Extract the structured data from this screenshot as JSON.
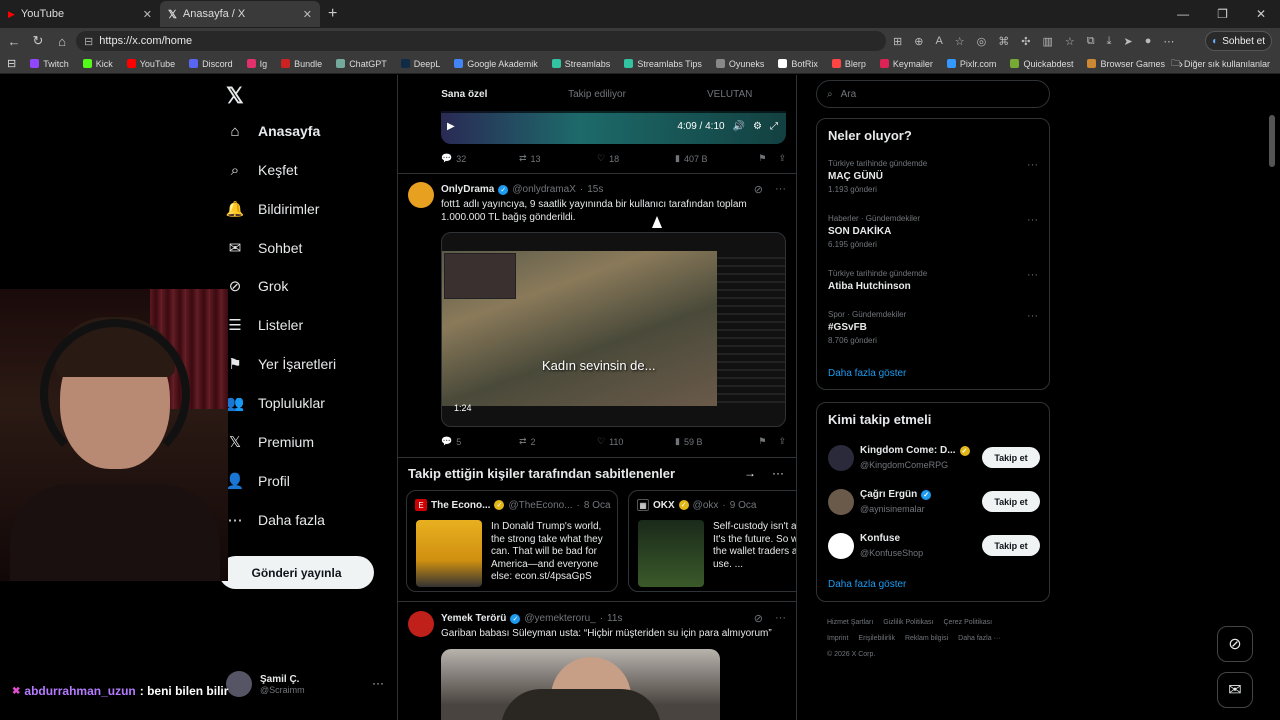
{
  "browser": {
    "tabs": [
      {
        "label": "YouTube",
        "active": false
      },
      {
        "label": "Anasayfa / X",
        "active": true
      }
    ],
    "url": "https://x.com/home",
    "sohbet_label": "Sohbet et",
    "bookmarks": [
      "Twitch",
      "Kick",
      "YouTube",
      "Discord",
      "Ig",
      "Bundle",
      "ChatGPT",
      "DeepL",
      "Google Akademik",
      "Streamlabs",
      "Streamlabs Tips",
      "Oyuneks",
      "BotRix",
      "Blerp",
      "Keymailer",
      "Pixlr.com",
      "Quickabdest",
      "Browser Games"
    ],
    "bookmarks_other": "Diğer sık kullanılanlar",
    "bookmark_colors": [
      "#9146ff",
      "#53fc18",
      "#ff0000",
      "#5865f2",
      "#e1306c",
      "#cc2222",
      "#74aa9c",
      "#0f2b46",
      "#4285f4",
      "#31c3a2",
      "#31c3a2",
      "#888888",
      "#ffffff",
      "#ff4444",
      "#dd2255",
      "#3399ff",
      "#77aa33",
      "#cc8833"
    ]
  },
  "nav": {
    "items": [
      {
        "label": "Anasayfa",
        "icon": "home-icon",
        "glyph": "⌂"
      },
      {
        "label": "Keşfet",
        "icon": "search-icon",
        "glyph": "⌕"
      },
      {
        "label": "Bildirimler",
        "icon": "bell-icon",
        "glyph": "🔔"
      },
      {
        "label": "Sohbet",
        "icon": "mail-icon",
        "glyph": "✉"
      },
      {
        "label": "Grok",
        "icon": "grok-icon",
        "glyph": "⊘"
      },
      {
        "label": "Listeler",
        "icon": "list-icon",
        "glyph": "☰"
      },
      {
        "label": "Yer İşaretleri",
        "icon": "bookmark-icon",
        "glyph": "⚑"
      },
      {
        "label": "Topluluklar",
        "icon": "communities-icon",
        "glyph": "👥"
      },
      {
        "label": "Premium",
        "icon": "x-premium-icon",
        "glyph": "𝕏"
      },
      {
        "label": "Profil",
        "icon": "profile-icon",
        "glyph": "👤"
      },
      {
        "label": "Daha fazla",
        "icon": "more-icon",
        "glyph": "⋯"
      }
    ],
    "post_button": "Gönderi yayınla",
    "profile": {
      "name": "Şamil Ç.",
      "handle": "@Scraimm"
    }
  },
  "overlay": {
    "chat_user": "abdurrahman_uzun",
    "chat_message": ": beni bilen bilir"
  },
  "feed": {
    "tabs": [
      "Sana özel",
      "Takip ediliyor",
      "VELUTAN"
    ],
    "video1": {
      "time": "4:09 / 4:10"
    },
    "tweet1_actions": {
      "replies": "32",
      "retweets": "13",
      "likes": "18",
      "views": "407 B"
    },
    "tweet2": {
      "name": "OnlyDrama",
      "handle": "@onlydramaX",
      "time": "15s",
      "text": "fott1 adlı yayıncıya, 9 saatlik yayınında bir kullanıcı tarafından toplam 1.000.000 TL bağış gönderildi.",
      "subtitle": "Kadın sevinsin de...",
      "duration": "1:24",
      "actions": {
        "replies": "5",
        "retweets": "2",
        "likes": "110",
        "views": "59 B"
      }
    },
    "pinned_title": "Takip ettiğin kişiler tarafından sabitlenenler",
    "pinned": [
      {
        "name": "The Econo...",
        "handle": "@TheEcono...",
        "time": "8 Oca",
        "text": "In Donald Trump's world, the strong take what they can. That will be bad for America—and everyone else: econ.st/4psaGpS"
      },
      {
        "name": "OKX",
        "handle": "@okx",
        "time": "9 Oca",
        "text": "Self-custody isn't a It's the future. So w the wallet traders a use. ..."
      }
    ],
    "tweet3": {
      "name": "Yemek Terörü",
      "handle": "@yemekteroru_",
      "time": "11s",
      "text": "Gariban babası Süleyman usta: “Hiçbir müşteriden su için para almıyorum”"
    }
  },
  "right": {
    "search_placeholder": "Ara",
    "trends_title": "Neler oluyor?",
    "trends": [
      {
        "context": "Türkiye tarihinde gündemde",
        "topic": "MAÇ GÜNÜ",
        "posts": "1.193 gönderi"
      },
      {
        "context": "Haberler · Gündemdekiler",
        "topic": "SON DAKİKA",
        "posts": "6.195 gönderi"
      },
      {
        "context": "Türkiye tarihinde gündemde",
        "topic": "Atiba Hutchinson",
        "posts": ""
      },
      {
        "context": "Spor · Gündemdekiler",
        "topic": "#GSvFB",
        "posts": "8.706 gönderi"
      }
    ],
    "trends_more": "Daha fazla göster",
    "follow_title": "Kimi takip etmeli",
    "follow": [
      {
        "name": "Kingdom Come: D...",
        "handle": "@KingdomComeRPG",
        "button": "Takip et"
      },
      {
        "name": "Çağrı Ergün",
        "handle": "@aynisinemalar",
        "button": "Takip et"
      },
      {
        "name": "Konfuse",
        "handle": "@KonfuseShop",
        "button": "Takip et"
      }
    ],
    "follow_more": "Daha fazla göster",
    "footer_links": [
      "Hizmet Şartları",
      "Gizlilik Politikası",
      "Çerez Politikası",
      "Imprint",
      "Erişilebilirlik",
      "Reklam bilgisi",
      "Daha fazla ···"
    ],
    "copyright": "© 2026 X Corp."
  }
}
